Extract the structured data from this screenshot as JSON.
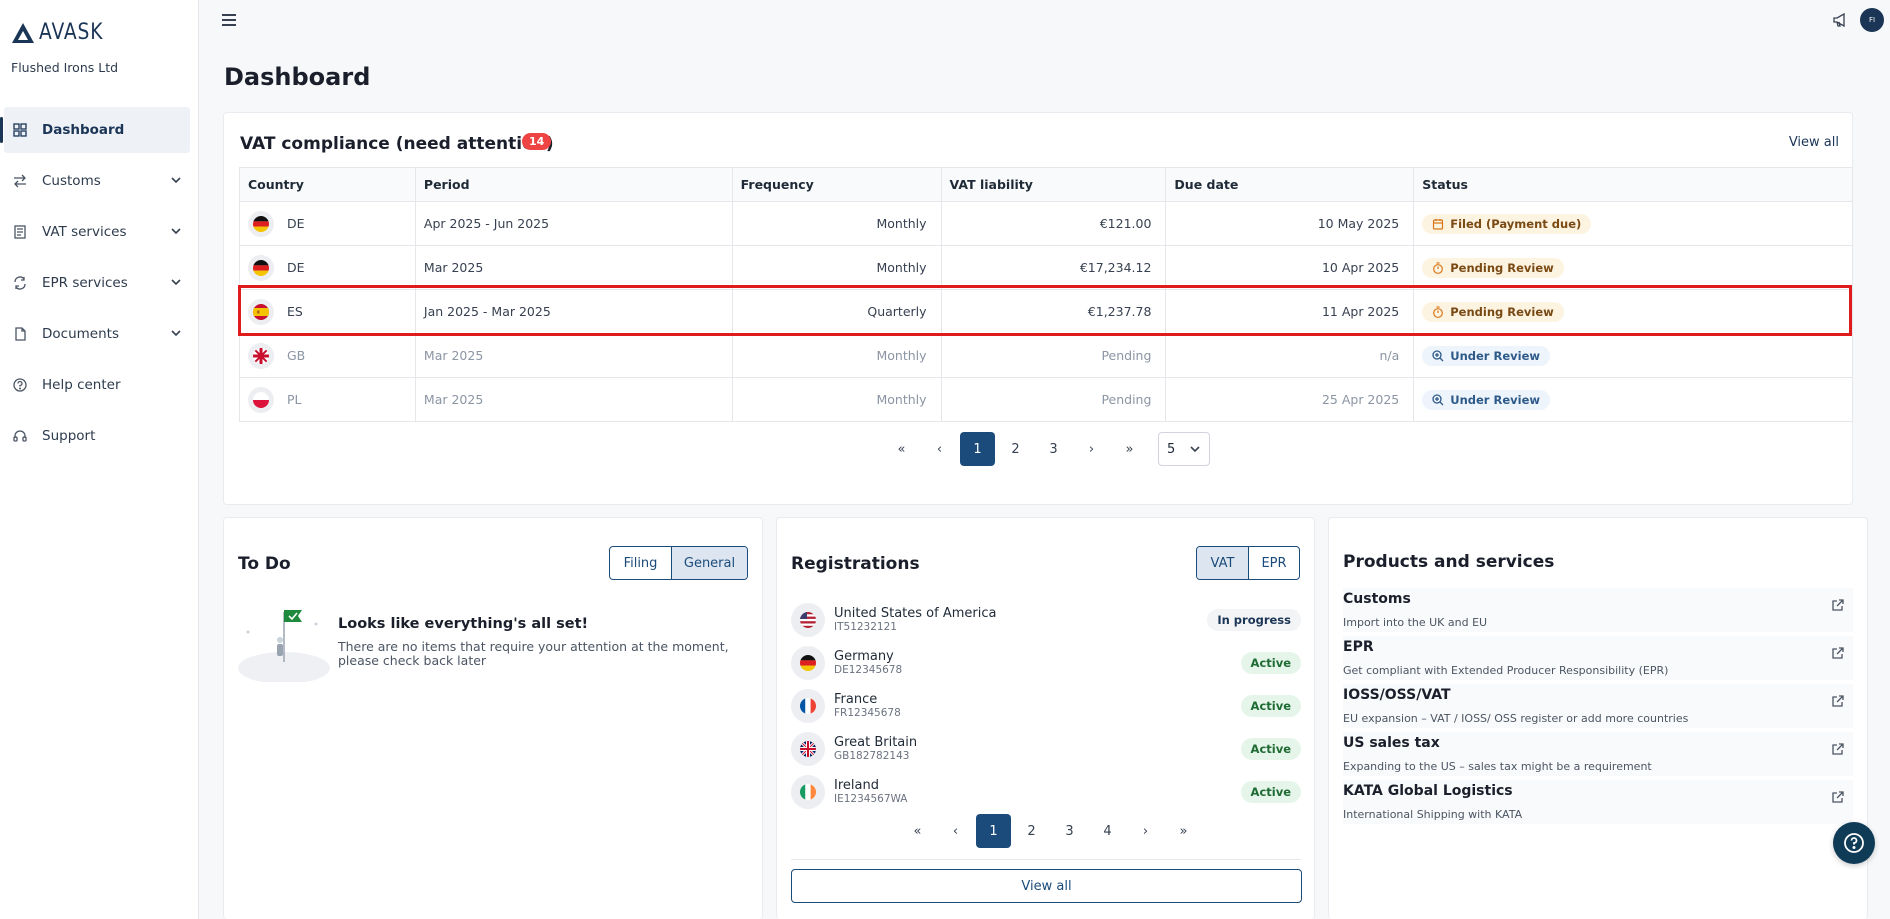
{
  "brand": {
    "logo_text": "AVASK",
    "company": "Flushed Irons Ltd"
  },
  "sidebar": {
    "items": [
      {
        "label": "Dashboard",
        "icon": "grid-icon"
      },
      {
        "label": "Customs",
        "icon": "arrows-icon"
      },
      {
        "label": "VAT services",
        "icon": "receipt-icon"
      },
      {
        "label": "EPR services",
        "icon": "recycle-icon"
      },
      {
        "label": "Documents",
        "icon": "document-icon"
      },
      {
        "label": "Help center",
        "icon": "help-circle-icon"
      },
      {
        "label": "Support",
        "icon": "headset-icon"
      }
    ]
  },
  "topbar": {
    "avatar_initials": "FI"
  },
  "page": {
    "title": "Dashboard"
  },
  "vat": {
    "title": "VAT compliance (need attention)",
    "count": "14",
    "view_all": "View all",
    "columns": [
      "Country",
      "Period",
      "Frequency",
      "VAT liability",
      "Due date",
      "Status"
    ],
    "rows": [
      {
        "country": "DE",
        "period": "Apr 2025 - Jun 2025",
        "frequency": "Monthly",
        "liability": "€121.00",
        "due": "10 May 2025",
        "status": "Filed (Payment due)"
      },
      {
        "country": "DE",
        "period": "Mar 2025",
        "frequency": "Monthly",
        "liability": "€17,234.12",
        "due": "10 Apr 2025",
        "status": "Pending Review"
      },
      {
        "country": "ES",
        "period": "Jan 2025 - Mar 2025",
        "frequency": "Quarterly",
        "liability": "€1,237.78",
        "due": "11 Apr 2025",
        "status": "Pending Review"
      },
      {
        "country": "GB",
        "period": "Mar 2025",
        "frequency": "Monthly",
        "liability": "Pending",
        "due": "n/a",
        "status": "Under Review"
      },
      {
        "country": "PL",
        "period": "Mar 2025",
        "frequency": "Monthly",
        "liability": "Pending",
        "due": "25 Apr 2025",
        "status": "Under Review"
      }
    ],
    "pager": {
      "pages": [
        "1",
        "2",
        "3"
      ],
      "page_size": "5"
    }
  },
  "todo": {
    "title": "To Do",
    "tabs": [
      "Filing",
      "General"
    ],
    "empty_title": "Looks like everything's all set!",
    "empty_text": "There are no items that require your attention at the moment, please check back later"
  },
  "registrations": {
    "title": "Registrations",
    "tabs": [
      "VAT",
      "EPR"
    ],
    "items": [
      {
        "name": "United States of America",
        "id": "IT51232121",
        "status": "In progress"
      },
      {
        "name": "Germany",
        "id": "DE12345678",
        "status": "Active"
      },
      {
        "name": "France",
        "id": "FR12345678",
        "status": "Active"
      },
      {
        "name": "Great Britain",
        "id": "GB182782143",
        "status": "Active"
      },
      {
        "name": "Ireland",
        "id": "IE1234567WA",
        "status": "Active"
      }
    ],
    "pager": {
      "pages": [
        "1",
        "2",
        "3",
        "4"
      ]
    },
    "view_all": "View all"
  },
  "products": {
    "title": "Products and services",
    "items": [
      {
        "name": "Customs",
        "desc": "Import into the UK and EU"
      },
      {
        "name": "EPR",
        "desc": "Get compliant with Extended Producer Responsibility (EPR)"
      },
      {
        "name": "IOSS/OSS/VAT",
        "desc": "EU expansion – VAT / IOSS/ OSS register or add more countries"
      },
      {
        "name": "US sales tax",
        "desc": "Expanding to the US – sales tax might be a requirement"
      },
      {
        "name": "KATA Global Logistics",
        "desc": "International Shipping with KATA"
      }
    ]
  },
  "colors": {
    "primary": "#1b4b7a",
    "brand": "#1b3556",
    "alert": "#ef4444",
    "highlight": "#e01b1b"
  }
}
